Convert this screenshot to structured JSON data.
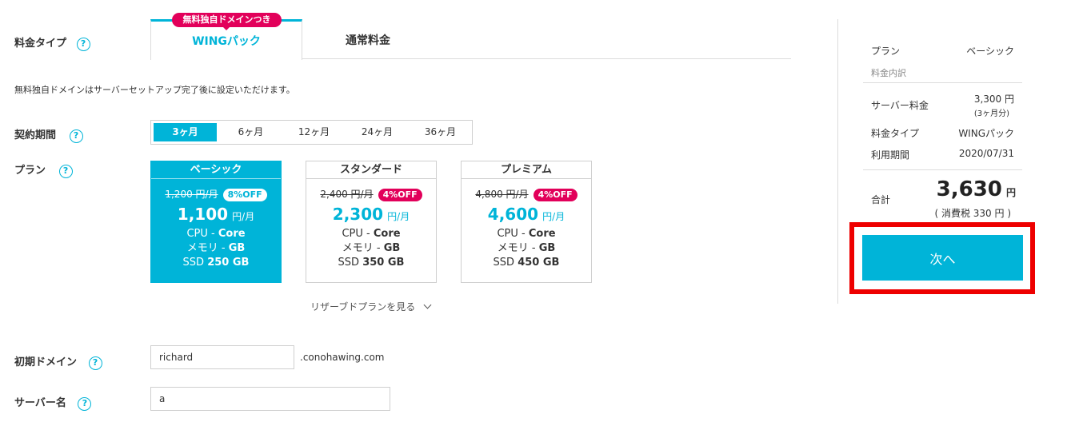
{
  "pricing_type": {
    "label": "料金タイプ",
    "badge": "無料独自ドメインつき",
    "tabs": [
      "WINGパック",
      "通常料金"
    ]
  },
  "note": "無料独自ドメインはサーバーセットアップ完了後に設定いただけます。",
  "period": {
    "label": "契約期間",
    "options": [
      "3ヶ月",
      "6ヶ月",
      "12ヶ月",
      "24ヶ月",
      "36ヶ月"
    ],
    "selected": "3ヶ月"
  },
  "plan": {
    "label": "プラン",
    "cards": [
      {
        "name": "ベーシック",
        "original": "1,200 円/月",
        "discount": "8%OFF",
        "price": "1,100",
        "unit": "円/月",
        "cpu_label": "CPU - ",
        "cpu": "Core",
        "mem_label": "メモリ - ",
        "mem": "GB",
        "ssd_label": "SSD ",
        "ssd": "250 GB"
      },
      {
        "name": "スタンダード",
        "original": "2,400 円/月",
        "discount": "4%OFF",
        "price": "2,300",
        "unit": "円/月",
        "cpu_label": "CPU - ",
        "cpu": "Core",
        "mem_label": "メモリ - ",
        "mem": "GB",
        "ssd_label": "SSD ",
        "ssd": "350 GB"
      },
      {
        "name": "プレミアム",
        "original": "4,800 円/月",
        "discount": "4%OFF",
        "price": "4,600",
        "unit": "円/月",
        "cpu_label": "CPU - ",
        "cpu": "Core",
        "mem_label": "メモリ - ",
        "mem": "GB",
        "ssd_label": "SSD ",
        "ssd": "450 GB"
      }
    ],
    "reserved_link": "リザーブドプランを見る"
  },
  "domain": {
    "label": "初期ドメイン",
    "value": "richard",
    "suffix": ".conohawing.com"
  },
  "server": {
    "label": "サーバー名",
    "value": "a"
  },
  "summary": {
    "plan_label": "プラン",
    "plan_value": "ベーシック",
    "breakdown_label": "料金内訳",
    "server_fee_label": "サーバー料金",
    "server_fee_value": "3,300 円",
    "server_fee_sub": "(3ヶ月分)",
    "type_label": "料金タイプ",
    "type_value": "WINGパック",
    "period_label": "利用期間",
    "period_value": "2020/07/31",
    "total_label": "合計",
    "total_value": "3,630",
    "total_unit": "円",
    "tax": "( 消費税 330 円 )",
    "next_button": "次へ"
  },
  "colors": {
    "accent": "#00b4d8",
    "badge": "#e2005a",
    "highlight": "#ee0000"
  }
}
